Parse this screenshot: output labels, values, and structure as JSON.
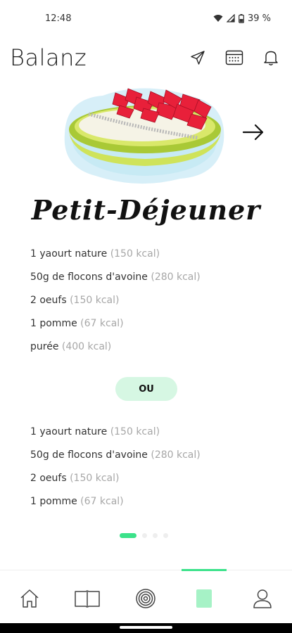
{
  "status_bar": {
    "time": "12:48",
    "battery": "39 %",
    "icons": [
      "wifi-icon",
      "signal-icon",
      "battery-icon"
    ]
  },
  "header": {
    "title": "Balanz",
    "icons": [
      "send-icon",
      "calendar-icon",
      "bell-icon"
    ]
  },
  "meal": {
    "title": "Petit-Déjeuner",
    "option_a": [
      {
        "food": "1 yaourt nature",
        "kcal": "(150 kcal)"
      },
      {
        "food": "50g de flocons d'avoine",
        "kcal": "(280 kcal)"
      },
      {
        "food": "2 oeufs",
        "kcal": "(150 kcal)"
      },
      {
        "food": "1 pomme",
        "kcal": "(67 kcal)"
      },
      {
        "food": "purée",
        "kcal": "(400 kcal)"
      }
    ],
    "separator": "OU",
    "option_b": [
      {
        "food": "1 yaourt nature",
        "kcal": "(150 kcal)"
      },
      {
        "food": "50g de flocons d'avoine",
        "kcal": "(280 kcal)"
      },
      {
        "food": "2 oeufs",
        "kcal": "(150 kcal)"
      },
      {
        "food": "1 pomme",
        "kcal": "(67 kcal)"
      }
    ]
  },
  "pagination": {
    "total": 4,
    "active": 1
  },
  "bottom_nav": {
    "items": [
      "home-icon",
      "book-icon",
      "target-icon",
      "meal-plan-icon",
      "profile-icon"
    ],
    "active": "meal-plan-icon"
  },
  "colors": {
    "accent": "#3be28a",
    "pill_bg": "#d6f7e3",
    "kcal_text": "#a7a7a7",
    "bowl": "#c8e04a",
    "berries": "#e8203a"
  }
}
